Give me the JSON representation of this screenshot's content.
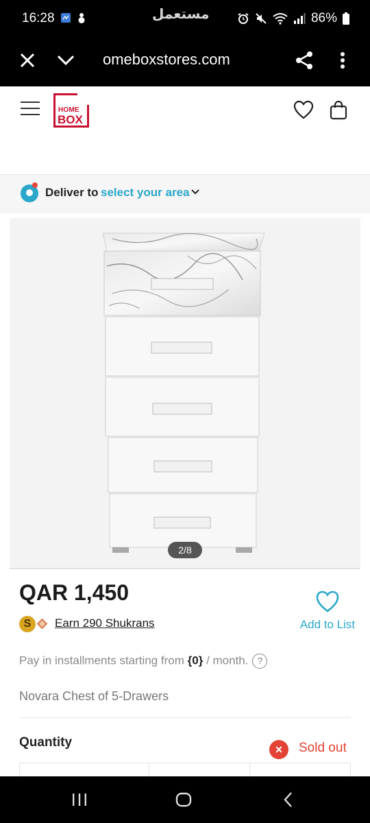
{
  "status_bar": {
    "time": "16:28",
    "center_text": "مستعمل",
    "battery_percent": "86%"
  },
  "browser": {
    "url": "omeboxstores.com"
  },
  "header": {
    "logo_line1": "HOME",
    "logo_line2": "BOX",
    "brand_color": "#c8102e"
  },
  "deliver": {
    "label": "Deliver to",
    "link": "select your area",
    "accent": "#2aa7c9"
  },
  "carousel": {
    "indicator": "2/8"
  },
  "product": {
    "price": "QAR 1,450",
    "shukran_coin": "S",
    "shukran_text": "Earn 290 Shukrans",
    "wishlist_label": "Add to List",
    "installments_prefix": "Pay in installments starting from ",
    "installments_value": "{0}",
    "installments_suffix": " / month.",
    "help_glyph": "?",
    "name": "Novara Chest of 5-Drawers",
    "quantity_label": "Quantity",
    "stock_status": "Sold out",
    "sold_out_color": "#e34234"
  }
}
